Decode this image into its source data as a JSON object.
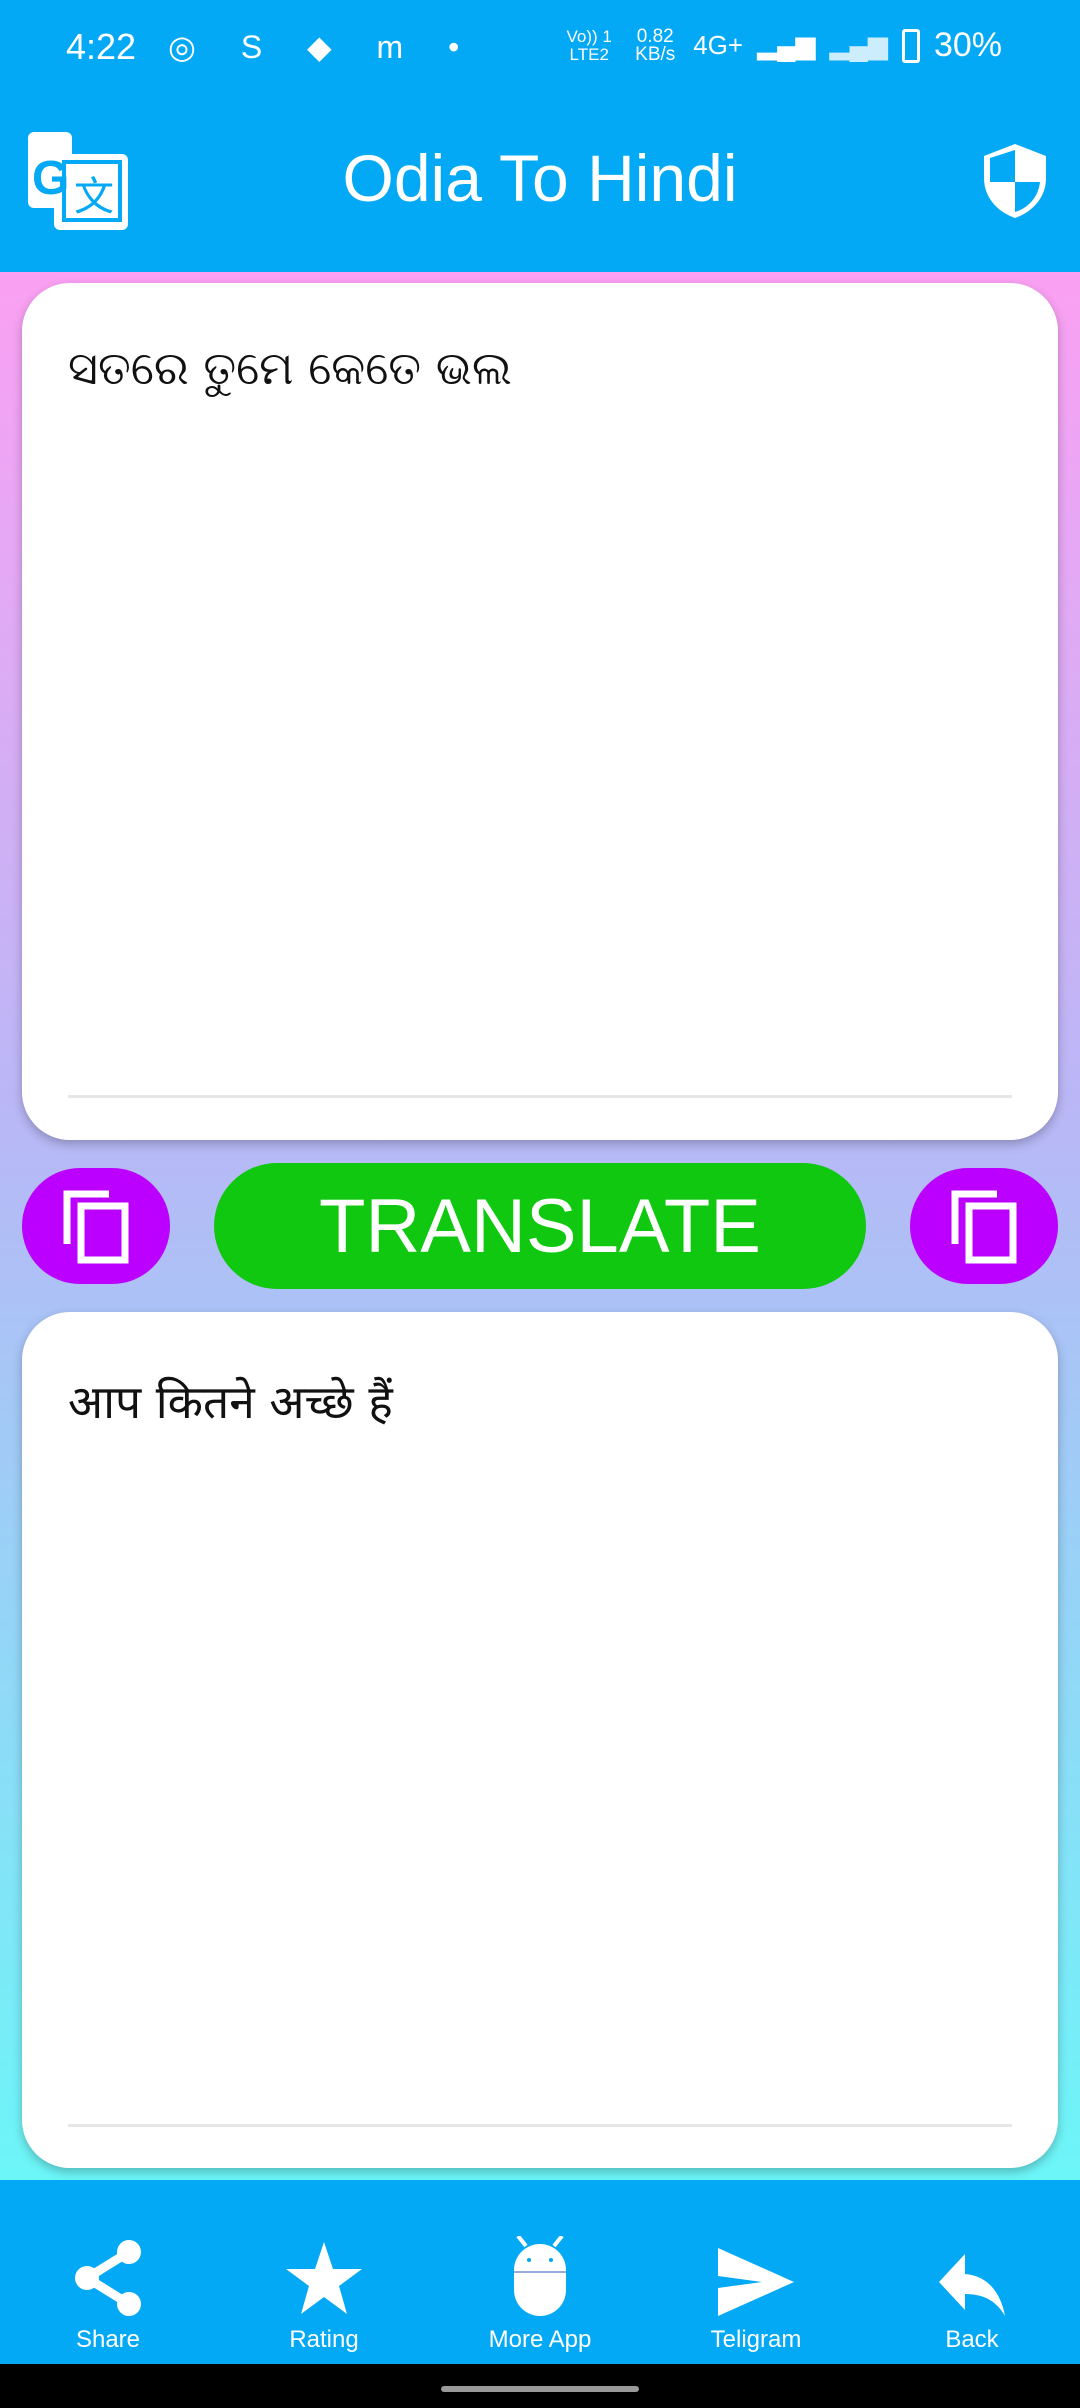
{
  "status_bar": {
    "time": "4:22",
    "notifications": "◎ S ◆ m •",
    "volte": "Vo)) 1 LTE2",
    "speed": "0.82 KB/s",
    "network": "4G+",
    "battery": "30%"
  },
  "header": {
    "title": "Odia To Hindi",
    "logo_icon": "google-translate-icon",
    "right_icon": "shield-icon"
  },
  "input": {
    "text": "ସତରେ ତୁମେ କେତେ ଭଲ"
  },
  "actions": {
    "translate_label": "TRANSLATE",
    "copy_icon": "copy-icon"
  },
  "output": {
    "text": "आप कितने अच्छे हैं"
  },
  "nav": {
    "items": [
      {
        "label": "Share",
        "icon": "share-icon"
      },
      {
        "label": "Rating",
        "icon": "star-icon"
      },
      {
        "label": "More App",
        "icon": "android-icon"
      },
      {
        "label": "Teligram",
        "icon": "send-icon"
      },
      {
        "label": "Back",
        "icon": "reply-icon"
      }
    ]
  },
  "colors": {
    "primary": "#03a9f4",
    "copy_button": "#bb00ff",
    "translate_button": "#0fc80f"
  }
}
